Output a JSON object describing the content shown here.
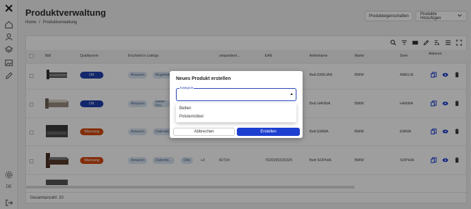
{
  "header": {
    "title": "Produktverwaltung",
    "breadcrumb": [
      "Home",
      "/",
      "Produktverwaltung"
    ],
    "btn_properties": "Produkteigenschaften",
    "btn_add": "Produkte Hinzufügen"
  },
  "sidebar": {
    "lang": "DE",
    "icons": [
      "logo-icon",
      "home-icon",
      "users-icon",
      "layers-icon",
      "image-icon",
      "edit-icon",
      "settings-icon",
      "logout-icon"
    ]
  },
  "table": {
    "columns": [
      "Bild",
      "Qualitynorm",
      "Erscheint in Listings",
      "uniqueIdent...",
      "EAN",
      "Artikelname",
      "Marke",
      "Serie",
      "Aktionen"
    ],
    "rows": [
      {
        "status": "OK",
        "status_type": "ok",
        "chips": [
          "Amazon",
          "Angebot"
        ],
        "extra": "",
        "id": "",
        "ean": "",
        "name": "Bett EMILIAN",
        "brand": "BMW",
        "series": "AMELIE"
      },
      {
        "status": "OK",
        "status_type": "ok",
        "chips": [
          "Amazon",
          "Bilder Dru"
        ],
        "extra": "",
        "id": "",
        "ean": "",
        "name": "Bett HANNA",
        "brand": "BMW",
        "series": "HANNA"
      },
      {
        "status": "Warnung",
        "status_type": "warn",
        "chips": [
          "Amazon",
          "Datenbl..."
        ],
        "extra": "",
        "id": "",
        "ean": "",
        "name": "Bett EMMA",
        "brand": "BMW",
        "series": "EMMA"
      },
      {
        "status": "Warnung",
        "status_type": "warn",
        "chips": [
          "Amazon",
          "Datenbl...",
          "Otto"
        ],
        "extra": "+2",
        "id": "82724",
        "ean": "7020295325325",
        "name": "Bett SOPHIA",
        "brand": "BMW",
        "series": "SOPHIA"
      }
    ],
    "footer": "Gesamtanzahl: 20"
  },
  "dialog": {
    "title": "Neues Produkt erstellen",
    "field_label": "Kategorie",
    "field_value": "",
    "options": [
      "Betten",
      "Polstermöbel"
    ],
    "cancel": "Abbrechen",
    "create": "Erstellen"
  },
  "colors": {
    "primary": "#1d3fd0",
    "ok": "#1d3fae",
    "warn": "#d4490e",
    "chip_bg": "#dbe6f3"
  }
}
